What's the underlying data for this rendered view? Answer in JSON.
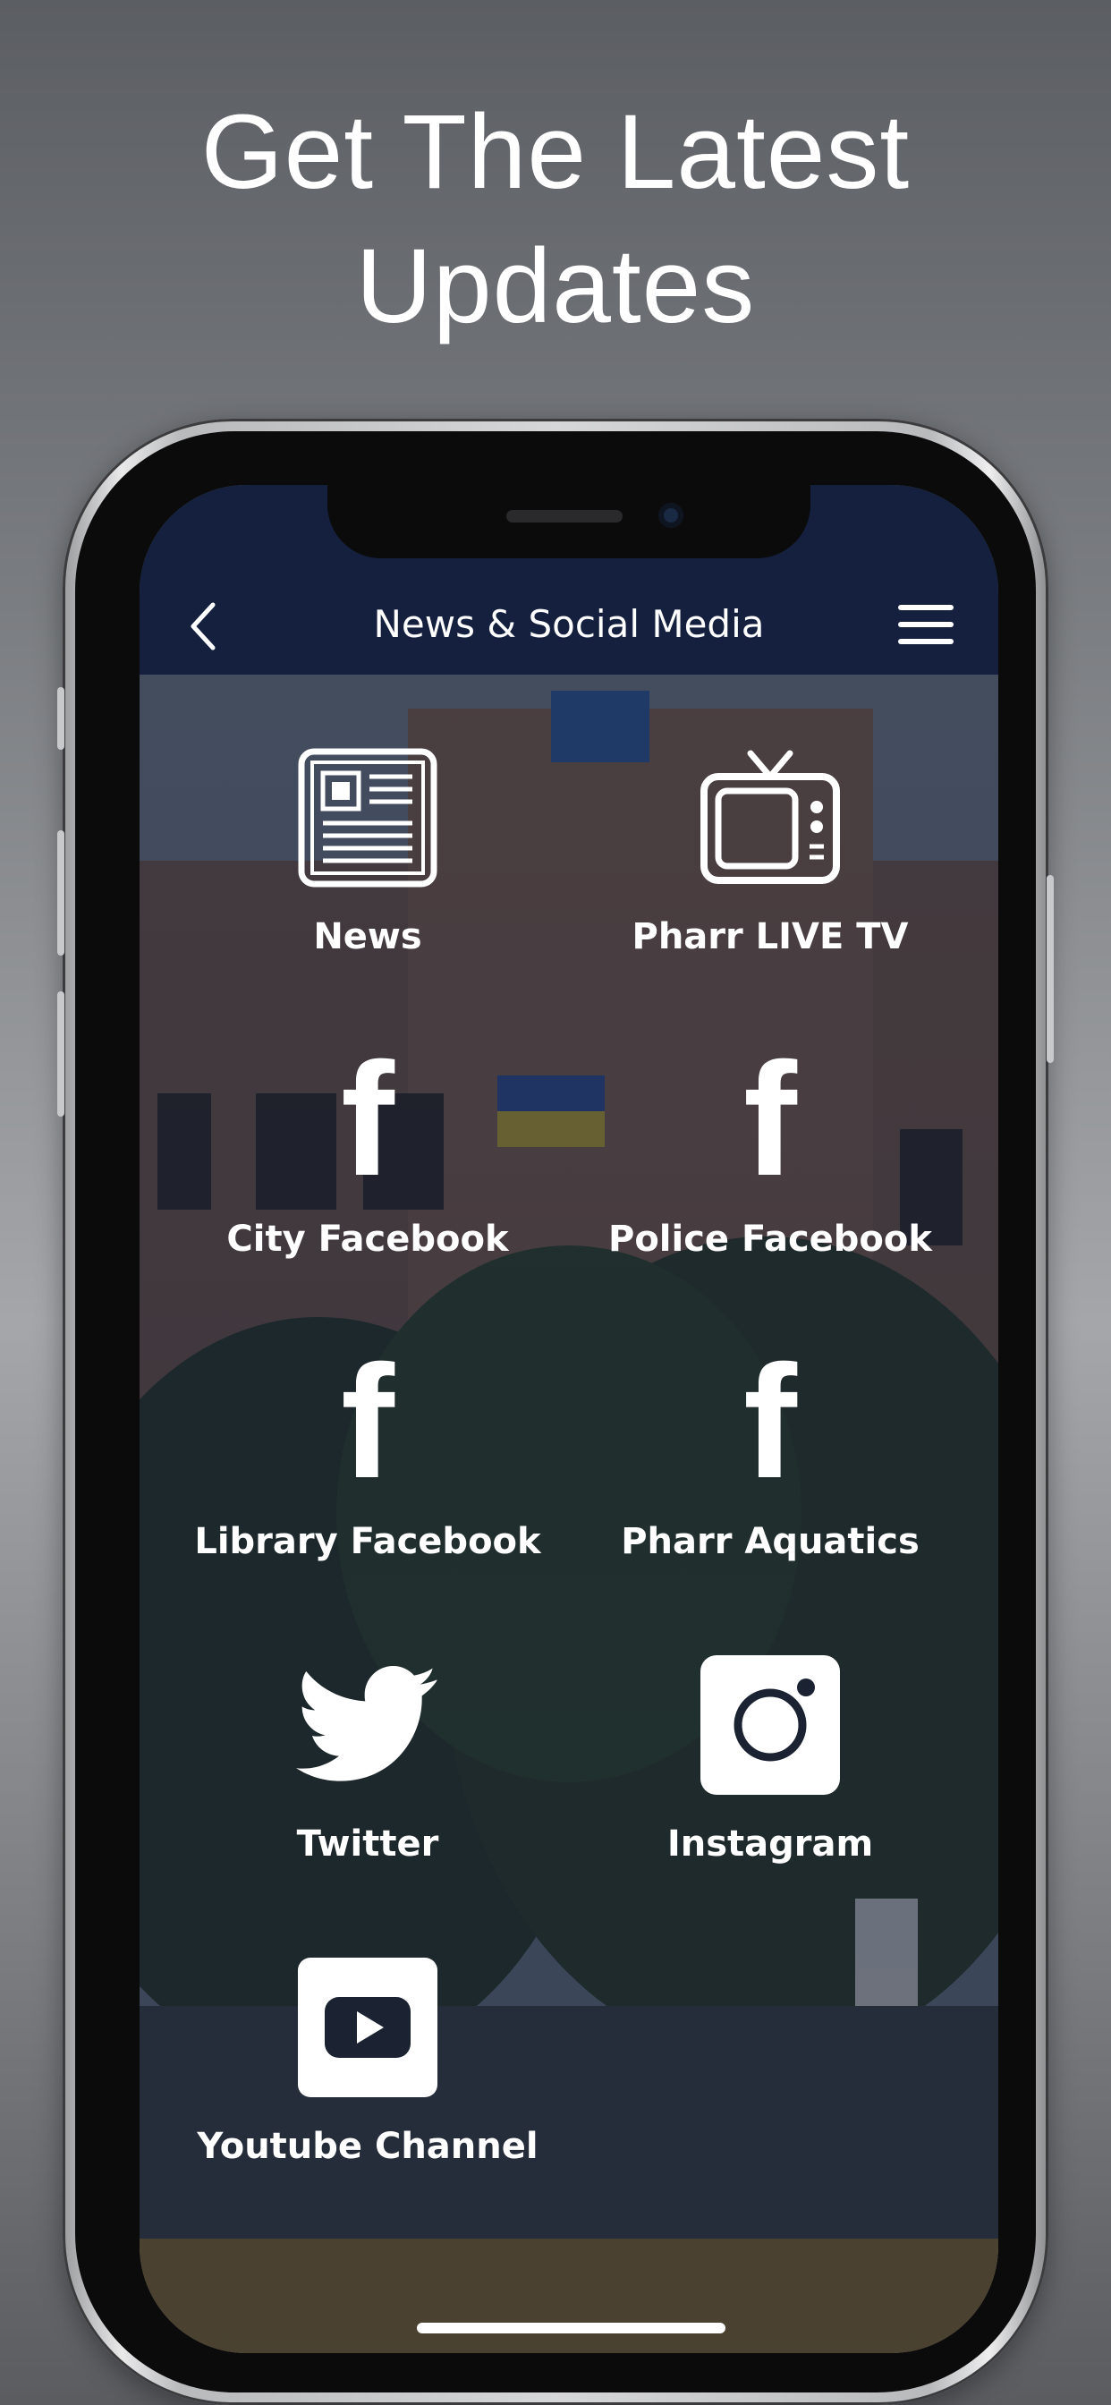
{
  "headline": {
    "line1": "Get The Latest",
    "line2": "Updates"
  },
  "navbar": {
    "title": "News & Social Media",
    "back_icon": "chevron-left-icon",
    "menu_icon": "hamburger-menu-icon",
    "background": "#14203d"
  },
  "tiles": [
    {
      "label": "News",
      "icon": "newspaper-icon"
    },
    {
      "label": "Pharr LIVE TV",
      "icon": "television-icon"
    },
    {
      "label": "City Facebook",
      "icon": "facebook-icon"
    },
    {
      "label": "Police Facebook",
      "icon": "facebook-icon"
    },
    {
      "label": "Library Facebook",
      "icon": "facebook-icon"
    },
    {
      "label": "Pharr Aquatics",
      "icon": "facebook-icon"
    },
    {
      "label": "Twitter",
      "icon": "twitter-icon"
    },
    {
      "label": "Instagram",
      "icon": "instagram-icon"
    },
    {
      "label": "Youtube Channel",
      "icon": "youtube-icon"
    }
  ],
  "colors": {
    "accent_text": "#ffffff",
    "overlay": "#162034"
  }
}
